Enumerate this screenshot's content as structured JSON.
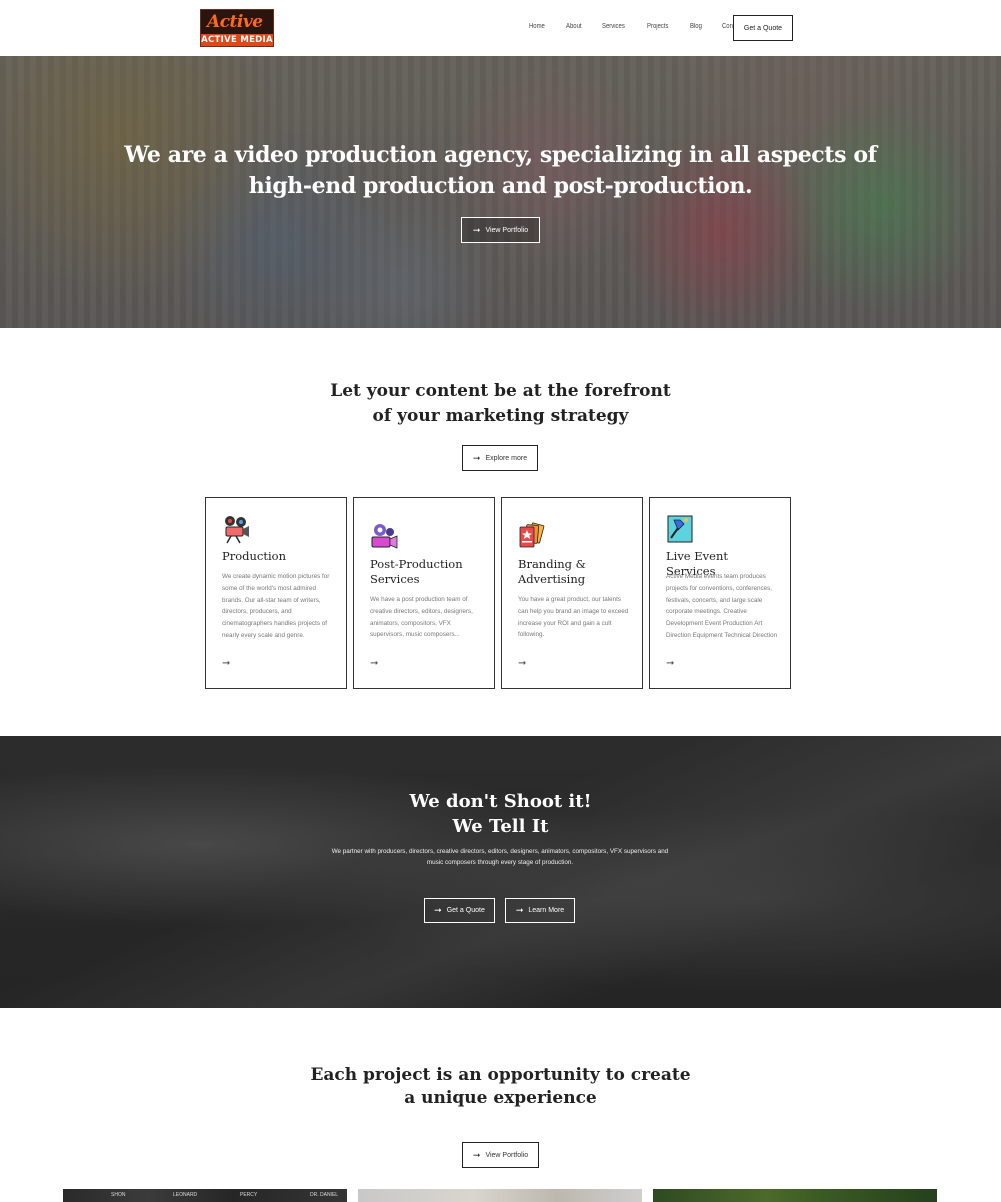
{
  "header": {
    "logo_top": "Active",
    "logo_bottom": "ACTIVE MEDIA",
    "nav": [
      "Home",
      "About",
      "Services",
      "Projects",
      "Blog",
      "Contact"
    ],
    "quote_button": "Get a Quote"
  },
  "hero": {
    "title_line1": "We are a video production agency, specializing in all aspects of",
    "title_line2": "high-end production and post-production.",
    "button": "View Portfolio"
  },
  "intro": {
    "title_line1": "Let your content be at the forefront",
    "title_line2": "of your marketing strategy",
    "button": "Explore more"
  },
  "services": [
    {
      "icon": "video-camera-icon",
      "title": "Production",
      "text": "We create dynamic motion pictures for some of the world's most admired brands. Our all-star team of writers, directors, producers, and cinematographers handles projects of nearly every scale and genre."
    },
    {
      "icon": "film-camera-icon",
      "title": "Post-Production Services",
      "text": "We have a post production team of creative directors, editors, designers, animators, compositors, VFX supervisors, music composers..."
    },
    {
      "icon": "brand-cards-icon",
      "title": "Branding & Advertising",
      "text": "You have a great product, our talents can help you brand an image to exceed increase your ROI and gain a cult following."
    },
    {
      "icon": "paint-brush-icon",
      "title": "Live Event Services",
      "text": "Active Media events team produces projects for conventions, conferences, festivals, concerts, and large scale corporate meetings. Creative Development Event Production Art Direction Equipment Technical Direction"
    }
  ],
  "tell": {
    "title_line1": "We don't Shoot it!",
    "title_line2": "We Tell It",
    "text": "We partner with producers, directors, creative directors, editors, designers, animators, compositors, VFX supervisors and music composers through every stage of production.",
    "button_quote": "Get a Quote",
    "button_learn": "Learn More"
  },
  "experience": {
    "title_line1": "Each project is an opportunity to create",
    "title_line2": "a unique experience",
    "button": "View Portfolio"
  },
  "thumb_labels": [
    "SHON",
    "LEONARD",
    "PERCY",
    "DR. DANIEL"
  ]
}
